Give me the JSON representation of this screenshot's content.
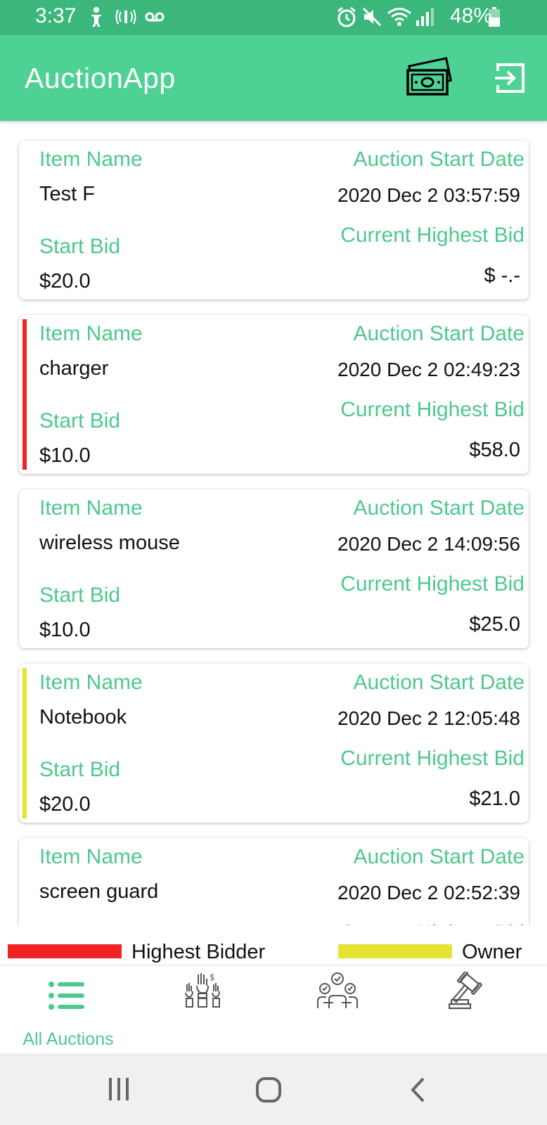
{
  "status_bar": {
    "time": "3:37",
    "battery": "48%"
  },
  "app_bar": {
    "title": "AuctionApp"
  },
  "labels": {
    "item_name": "Item Name",
    "auction_start_date": "Auction Start Date",
    "start_bid": "Start Bid",
    "current_highest_bid": "Current Highest Bid"
  },
  "auctions": [
    {
      "name": "Test F",
      "start_date": "2020 Dec 2 03:57:59",
      "start_bid": "$20.0",
      "highest_bid": "$ -.-",
      "marker": "none"
    },
    {
      "name": "charger",
      "start_date": "2020 Dec 2 02:49:23",
      "start_bid": "$10.0",
      "highest_bid": "$58.0",
      "marker": "highest-bidder"
    },
    {
      "name": "wireless mouse",
      "start_date": "2020 Dec 2 14:09:56",
      "start_bid": "$10.0",
      "highest_bid": "$25.0",
      "marker": "none"
    },
    {
      "name": "Notebook",
      "start_date": "2020 Dec 2 12:05:48",
      "start_bid": "$20.0",
      "highest_bid": "$21.0",
      "marker": "owner"
    },
    {
      "name": "screen guard",
      "start_date": "2020 Dec 2 02:52:39",
      "start_bid": "",
      "highest_bid": "",
      "marker": "none"
    }
  ],
  "legend": {
    "highest_bidder": "Highest Bidder",
    "owner": "Owner"
  },
  "bottom_nav": {
    "all_auctions": "All Auctions"
  },
  "colors": {
    "primary": "#4ed195",
    "status_bar": "#3bb77c",
    "accent_text": "#4ec88d",
    "highest_bidder": "#f02424",
    "owner": "#e3e530"
  },
  "icons": {
    "app_bar": [
      "money-icon",
      "logout-icon"
    ],
    "bottom_nav": [
      "list-icon",
      "bidding-hands-icon",
      "vote-people-icon",
      "gavel-icon"
    ],
    "system_nav": [
      "recents-icon",
      "home-icon",
      "back-icon"
    ]
  }
}
